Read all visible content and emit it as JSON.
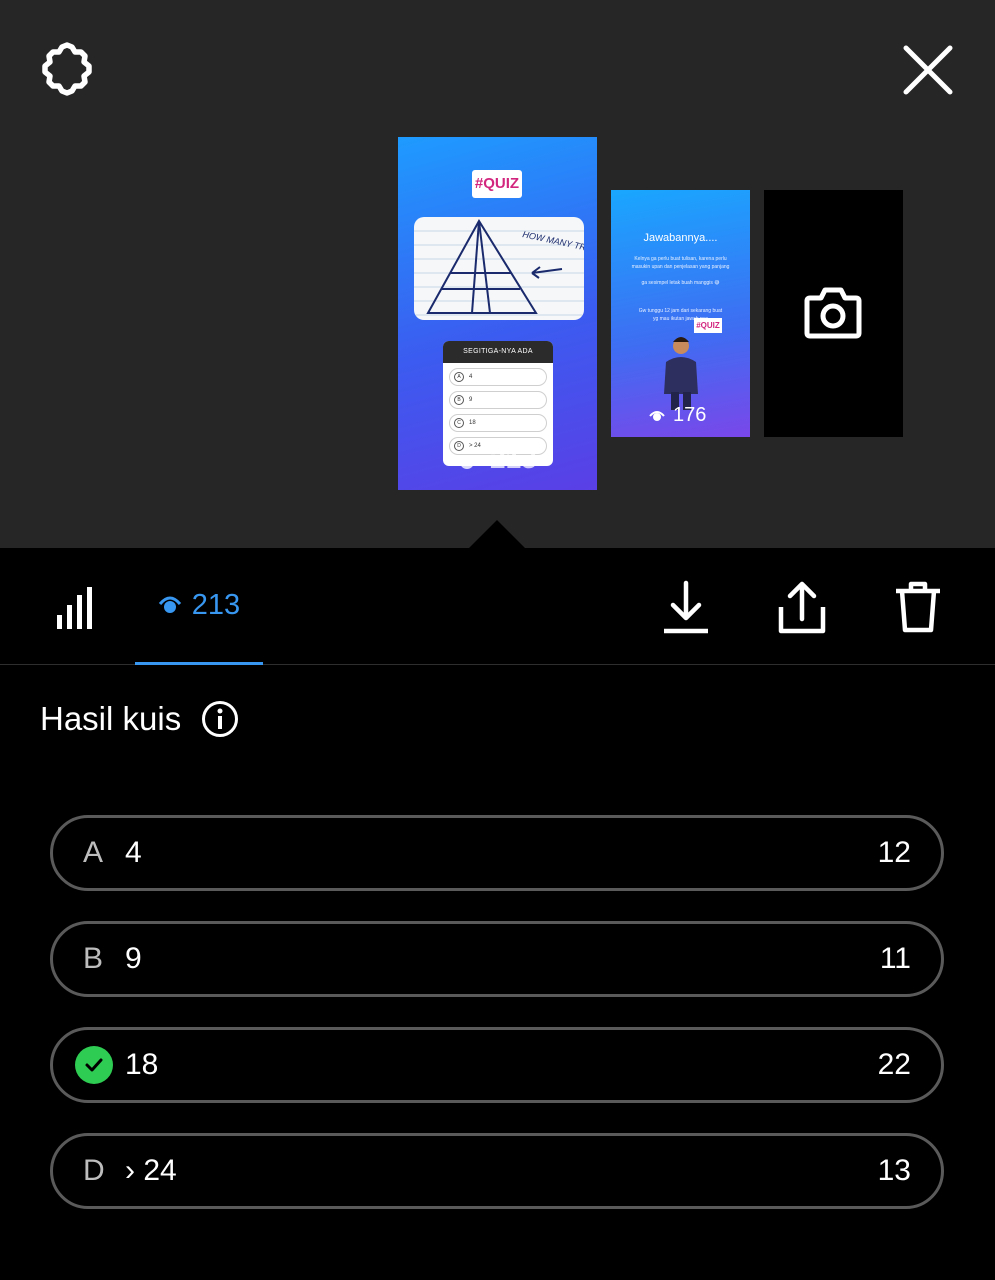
{
  "stories": [
    {
      "tag": "#QUIZ",
      "drawing_text": "HOW MANY TRIANGLES?",
      "quiz_question": "SEGITIGA-NYA ADA",
      "quiz_options": [
        {
          "letter": "A",
          "text": "4"
        },
        {
          "letter": "B",
          "text": "9"
        },
        {
          "letter": "C",
          "text": "18"
        },
        {
          "letter": "D",
          "text": "> 24"
        }
      ],
      "views": "213"
    },
    {
      "title": "Jawabannya....",
      "lines": [
        "Kelnya ga perlu buat tulisan, karena perlu",
        "masukin upan dan penjelasan yang panjang",
        "ga sesimpel letak buah manggis 😅",
        "Gw tunggu 12 jam dari sekarang buat",
        "yg mau ikutan jawab         nya"
      ],
      "tag": "#QUIZ",
      "views": "176"
    },
    {
      "icon": "camera-icon"
    }
  ],
  "toolbar": {
    "views_count": "213"
  },
  "results": {
    "title": "Hasil kuis",
    "options": [
      {
        "letter": "A",
        "text": "4",
        "count": "12",
        "correct": false
      },
      {
        "letter": "B",
        "text": "9",
        "count": "11",
        "correct": false
      },
      {
        "letter": "",
        "text": "18",
        "count": "22",
        "correct": true
      },
      {
        "letter": "D",
        "text": "› 24",
        "count": "13",
        "correct": false
      }
    ]
  },
  "colors": {
    "accent": "#3897f0",
    "correct": "#2ecc52",
    "top_bg": "#262626"
  }
}
